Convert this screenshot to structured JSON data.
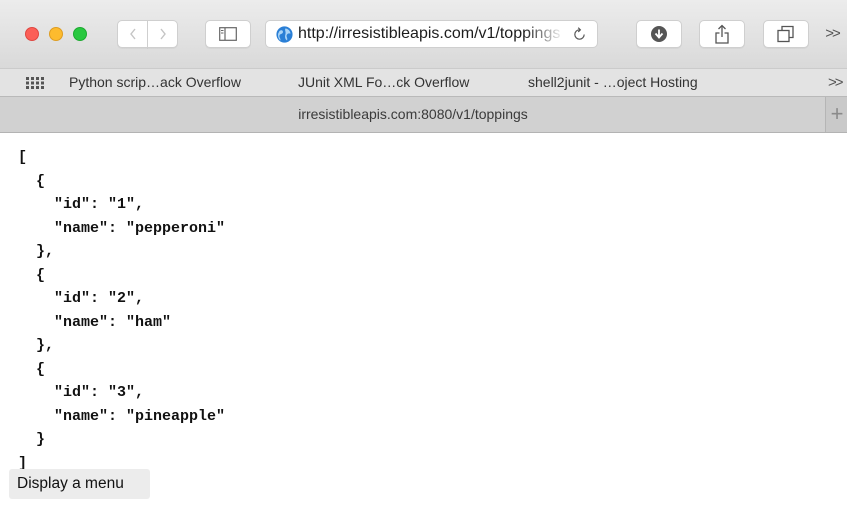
{
  "toolbar": {
    "address": {
      "url": "http://irresistibleapis.com/v1/toppings"
    }
  },
  "favorites": {
    "items": [
      "Python scrip…ack Overflow",
      "JUnit XML Fo…ck Overflow",
      "shell2junit - …oject Hosting"
    ],
    "more_label": ">>"
  },
  "tabs": {
    "active_title": "irresistibleapis.com:8080/v1/toppings",
    "new_tab_label": "+"
  },
  "content": {
    "json_lines": [
      "[",
      "  {",
      "    \"id\": \"1\",",
      "    \"name\": \"pepperoni\"",
      "  },",
      "  {",
      "    \"id\": \"2\",",
      "    \"name\": \"ham\"",
      "  },",
      "  {",
      "    \"id\": \"3\",",
      "    \"name\": \"pineapple\"",
      "  }",
      "]"
    ],
    "menu_button_label": "Display a menu"
  },
  "icons": {
    "close": "close-icon",
    "minimize": "minimize-icon",
    "zoom": "zoom-icon",
    "back": "chevron-left-icon",
    "forward": "chevron-right-icon",
    "sidebar": "sidebar-icon",
    "site": "globe-icon",
    "reload": "reload-icon",
    "download": "download-icon",
    "share": "share-icon",
    "tabs": "tabs-overview-icon",
    "more": "chevron-double-right-icon",
    "favorites_grid": "grid-icon"
  },
  "colors": {
    "traffic_red": "#fc5f57",
    "traffic_yellow": "#fdbb2e",
    "traffic_green": "#29c840",
    "globe_blue": "#2a7fd6"
  }
}
